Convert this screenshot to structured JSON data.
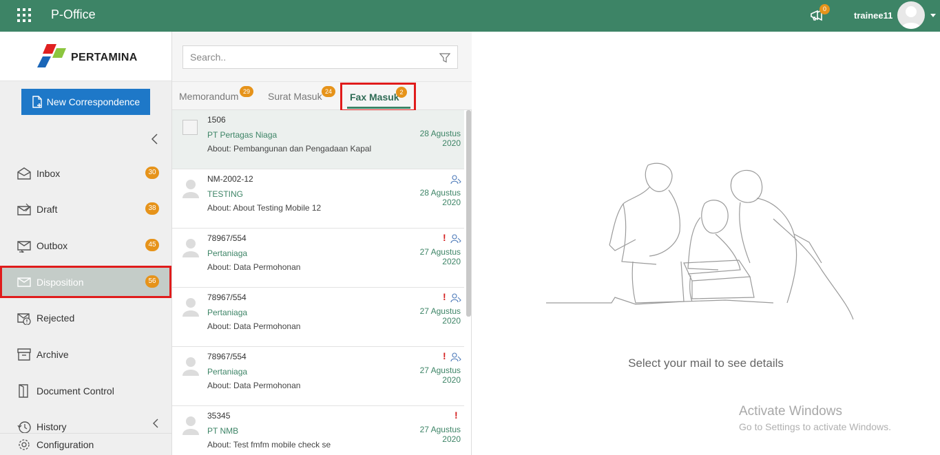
{
  "topbar": {
    "app_title": "P-Office",
    "notification_count": "0",
    "username": "trainee11",
    "color": "#3d8466"
  },
  "sidebar": {
    "logo_text": "PERTAMINA",
    "new_button": "New Correspondence",
    "items": [
      {
        "label": "Inbox",
        "badge": "30",
        "icon": "inbox-icon"
      },
      {
        "label": "Draft",
        "badge": "38",
        "icon": "draft-icon"
      },
      {
        "label": "Outbox",
        "badge": "45",
        "icon": "outbox-icon"
      },
      {
        "label": "Disposition",
        "badge": "56",
        "icon": "disposition-icon",
        "active": true
      },
      {
        "label": "Rejected",
        "icon": "rejected-icon"
      },
      {
        "label": "Archive",
        "icon": "archive-icon"
      },
      {
        "label": "Document Control",
        "icon": "document-control-icon"
      },
      {
        "label": "History",
        "icon": "history-icon"
      }
    ],
    "config_label": "Configuration"
  },
  "search": {
    "placeholder": "Search.."
  },
  "tabs": [
    {
      "label": "Memorandum",
      "badge": "29"
    },
    {
      "label": "Surat Masuk",
      "badge": "24"
    },
    {
      "label": "Fax Masuk",
      "badge": "2",
      "active": true
    }
  ],
  "mails": [
    {
      "number": "1506",
      "from": "PT Pertagas Niaga",
      "date": "28 Agustus 2020",
      "about": "About: Pembangunan dan Pengadaan Kapal",
      "urgent": false,
      "disposition": false
    },
    {
      "number": "NM-2002-12",
      "from": "TESTING",
      "date": "28 Agustus 2020",
      "about": "About: About Testing Mobile 12",
      "urgent": false,
      "disposition": true
    },
    {
      "number": "78967/554",
      "from": "Pertaniaga",
      "date": "27 Agustus 2020",
      "about": "About: Data Permohonan",
      "urgent": true,
      "disposition": true
    },
    {
      "number": "78967/554",
      "from": "Pertaniaga",
      "date": "27 Agustus 2020",
      "about": "About: Data Permohonan",
      "urgent": true,
      "disposition": true
    },
    {
      "number": "78967/554",
      "from": "Pertaniaga",
      "date": "27 Agustus 2020",
      "about": "About: Data Permohonan",
      "urgent": true,
      "disposition": true
    },
    {
      "number": "35345",
      "from": "PT NMB",
      "date": "27 Agustus 2020",
      "about": "About: Test fmfm mobile check se",
      "urgent": true,
      "disposition": false
    }
  ],
  "detail": {
    "empty_message": "Select your mail to see details",
    "watermark_title": "Activate Windows",
    "watermark_sub": "Go to Settings to activate Windows."
  }
}
